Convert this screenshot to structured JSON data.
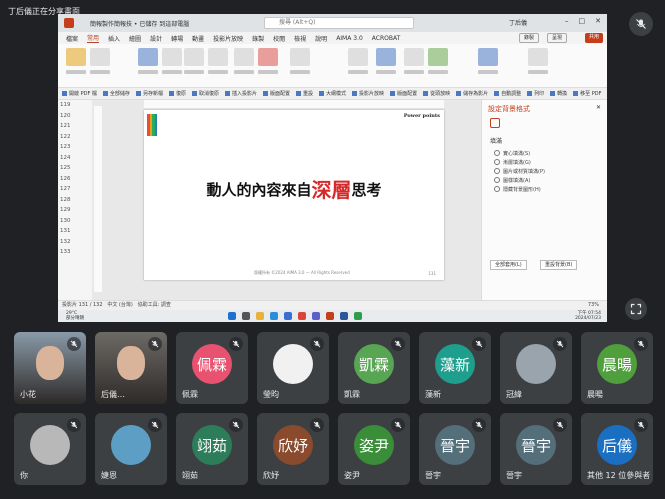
{
  "meeting": {
    "presenter_label": "丁后儀正在分享畫面"
  },
  "ppt": {
    "doc_title": "簡報製作簡報技 • 已儲存 到這部電腦",
    "search_placeholder": "搜尋 (Alt+Q)",
    "user_name": "丁后儀",
    "tabs": [
      "檔案",
      "常用",
      "插入",
      "繪圖",
      "設計",
      "轉場",
      "動畫",
      "投影片放映",
      "錄製",
      "校閱",
      "檢視",
      "說明",
      "AIMA 3.0",
      "ACROBAT"
    ],
    "active_tab": "常用",
    "record_label": "錄製",
    "present_label": "呈現",
    "share_label": "共用",
    "quick_actions": [
      "開啟 PDF 檔",
      "全部儲存",
      "另存新檔",
      "復原",
      "取消復原",
      "插入投影片",
      "版面配置",
      "重設",
      "大綱模式",
      "投影片放映",
      "版面配置",
      "從頭放映",
      "儲存為影片",
      "自動調整",
      "列印",
      "轉換",
      "移至 PDF",
      "列印預覽"
    ],
    "slide_numbers": [
      "119",
      "120",
      "121",
      "122",
      "123",
      "124",
      "125",
      "126",
      "127",
      "128",
      "129",
      "130",
      "131",
      "132",
      "133"
    ],
    "slide": {
      "logo": "Power points",
      "headline_before": "動人的內容來自",
      "headline_highlight": "深層",
      "headline_after": "思考",
      "footer": "版權所有 ©2024 AIMA 3.0 — All Rights Reserved",
      "slide_no": "131"
    },
    "format_pane": {
      "title": "設定背景格式",
      "section": "填滿",
      "options": [
        "實心填滿(S)",
        "漸層填滿(G)",
        "圖片或材質填滿(P)",
        "圖樣填滿(A)",
        "隱藏背景圖形(H)"
      ],
      "apply_all": "全部套用(L)",
      "reset": "重設背景(B)"
    },
    "status": {
      "slide_info": "投影片 131 / 132",
      "lang": "中文 (台灣)",
      "accessibility": "協助工具: 調查",
      "zoom": "73%"
    },
    "taskbar": {
      "temp": "29°C",
      "weather": "部分晴朗",
      "time": "下午 07:54",
      "date": "2024/07/23"
    }
  },
  "participants": [
    {
      "name": "小花",
      "initials": "",
      "color": "#8a9aa8",
      "type": "video"
    },
    {
      "name": "后儀…",
      "initials": "",
      "color": "#6d6a66",
      "type": "video"
    },
    {
      "name": "佩霖",
      "initials": "佩霖",
      "color": "#e8516f",
      "type": "initials"
    },
    {
      "name": "瑩昀",
      "initials": "",
      "color": "#f1f1f1",
      "type": "photo"
    },
    {
      "name": "凱霖",
      "initials": "凱霖",
      "color": "#58a553",
      "type": "initials"
    },
    {
      "name": "藻新",
      "initials": "藻新",
      "color": "#1e9e8c",
      "type": "initials"
    },
    {
      "name": "冠緯",
      "initials": "",
      "color": "#9aa4ad",
      "type": "photo"
    },
    {
      "name": "晨暘",
      "initials": "晨暘",
      "color": "#4f9f3c",
      "type": "initials"
    },
    {
      "name": "你",
      "initials": "",
      "color": "#b8b8b8",
      "type": "photo"
    },
    {
      "name": "婕恩",
      "initials": "",
      "color": "#5d9ec4",
      "type": "photo"
    },
    {
      "name": "翊茹",
      "initials": "翊茹",
      "color": "#2e7d5a",
      "type": "initials"
    },
    {
      "name": "欣妤",
      "initials": "欣妤",
      "color": "#8a4a2e",
      "type": "initials"
    },
    {
      "name": "姿尹",
      "initials": "姿尹",
      "color": "#3a8e3a",
      "type": "initials"
    },
    {
      "name": "晉宇",
      "initials": "晉宇",
      "color": "#546e7a",
      "type": "initials"
    },
    {
      "name": "晉宇",
      "initials": "晉宇",
      "color": "#546e7a",
      "type": "initials"
    },
    {
      "name": "其他 12 位參與者",
      "initials": "后儀",
      "color": "#1a6fc2",
      "type": "initials"
    }
  ],
  "icons": {
    "mic_off": "mic-off-icon",
    "expand": "expand-icon"
  },
  "colors": {
    "background": "#202124",
    "tile": "#3c4043",
    "accent_ppt": "#c43e1c",
    "highlight_text": "#d62a2a"
  }
}
